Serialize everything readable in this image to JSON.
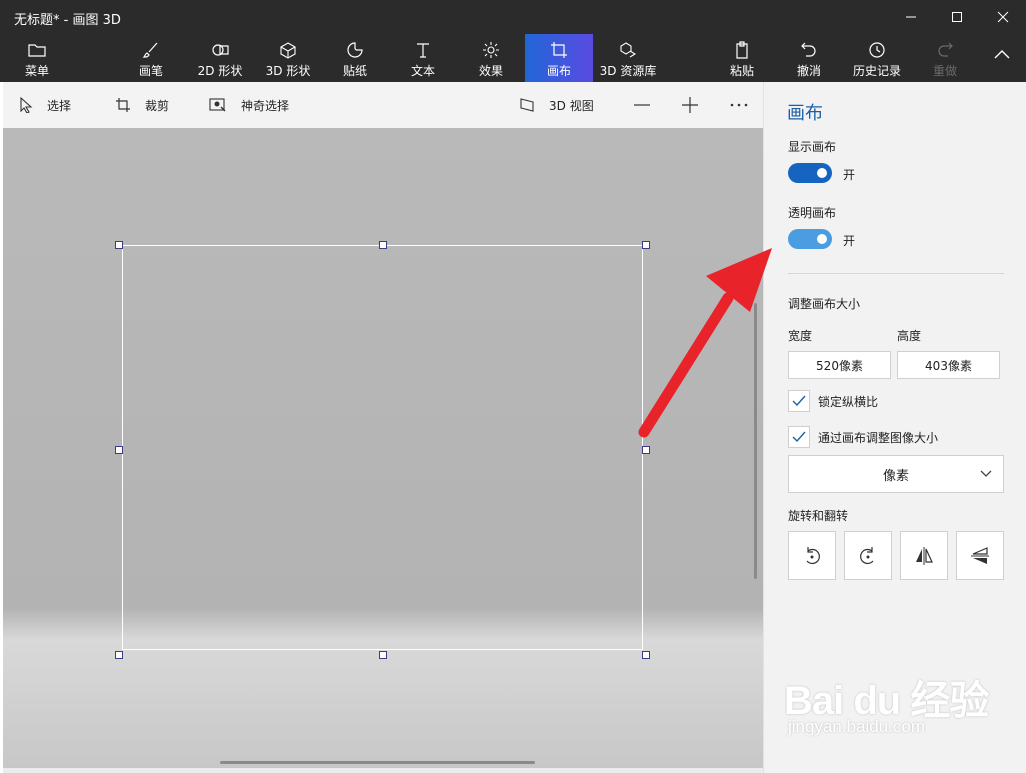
{
  "window": {
    "title": "无标题* - 画图 3D",
    "minimize_icon": "minimize-icon",
    "maximize_icon": "maximize-icon",
    "close_icon": "close-icon"
  },
  "ribbon": {
    "menu": "菜单",
    "items": [
      {
        "label": "画笔",
        "icon": "brush-icon"
      },
      {
        "label": "2D 形状",
        "icon": "2d-shapes-icon"
      },
      {
        "label": "3D 形状",
        "icon": "3d-shapes-icon"
      },
      {
        "label": "贴纸",
        "icon": "sticker-icon"
      },
      {
        "label": "文本",
        "icon": "text-icon"
      },
      {
        "label": "效果",
        "icon": "effects-icon"
      },
      {
        "label": "画布",
        "icon": "canvas-icon"
      },
      {
        "label": "3D 资源库",
        "icon": "3d-library-icon"
      }
    ],
    "paste": "粘贴",
    "undo": "撤消",
    "history": "历史记录",
    "redo": "重做",
    "active_color": "#2166d8"
  },
  "toolbar": {
    "select": "选择",
    "crop": "裁剪",
    "magic_select": "神奇选择",
    "view3d": "3D 视图",
    "zoom_out": "—",
    "zoom_in": "+",
    "more": "···"
  },
  "panel": {
    "title": "画布",
    "show_canvas_label": "显示画布",
    "show_canvas_state": "开",
    "show_canvas_on": true,
    "transparent_label": "透明画布",
    "transparent_state": "开",
    "transparent_on": true,
    "resize_label": "调整画布大小",
    "width_label": "宽度",
    "height_label": "高度",
    "width_value": "520像素",
    "height_value": "403像素",
    "lock_ratio_label": "锁定纵横比",
    "lock_ratio_checked": true,
    "resize_image_label": "通过画布调整图像大小",
    "resize_image_checked": true,
    "unit": "像素",
    "rotate_label": "旋转和翻转",
    "toggle_color_dark": "#1565c0",
    "toggle_color_light": "#4a9de0"
  },
  "watermark": {
    "logo": "Bai du 经验",
    "url": "jingyan.baidu.com"
  }
}
